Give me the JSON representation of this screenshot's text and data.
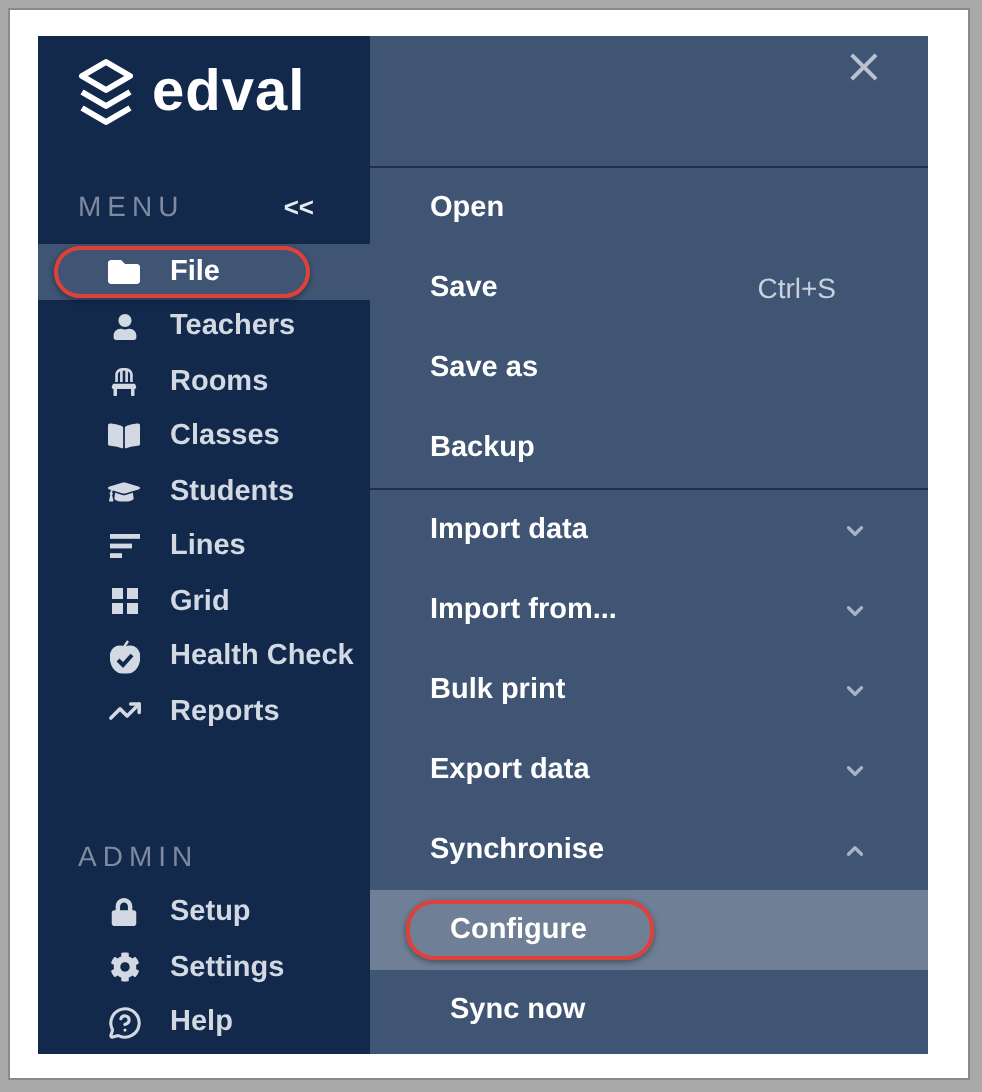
{
  "logo": {
    "text": "edval"
  },
  "sidebar": {
    "heading": "MENU",
    "collapse": "<<",
    "items": [
      {
        "label": "File",
        "selected": true,
        "circled": true
      },
      {
        "label": "Teachers",
        "selected": false,
        "circled": false
      },
      {
        "label": "Rooms",
        "selected": false,
        "circled": false
      },
      {
        "label": "Classes",
        "selected": false,
        "circled": false
      },
      {
        "label": "Students",
        "selected": false,
        "circled": false
      },
      {
        "label": "Lines",
        "selected": false,
        "circled": false
      },
      {
        "label": "Grid",
        "selected": false,
        "circled": false
      },
      {
        "label": "Health Check",
        "selected": false,
        "circled": false
      },
      {
        "label": "Reports",
        "selected": false,
        "circled": false
      }
    ],
    "admin_heading": "ADMIN",
    "admin_items": [
      {
        "label": "Setup",
        "selected": false
      },
      {
        "label": "Settings",
        "selected": false
      },
      {
        "label": "Help",
        "selected": false
      }
    ]
  },
  "file_menu": {
    "close": "×",
    "groups": [
      [
        {
          "label": "Open"
        },
        {
          "label": "Save",
          "shortcut": "Ctrl+S"
        },
        {
          "label": "Save as"
        },
        {
          "label": "Backup"
        }
      ],
      [
        {
          "label": "Import data",
          "expanded": false
        },
        {
          "label": "Import from...",
          "expanded": false
        },
        {
          "label": "Bulk print",
          "expanded": false
        },
        {
          "label": "Export data",
          "expanded": false
        },
        {
          "label": "Synchronise",
          "expanded": true,
          "children": [
            {
              "label": "Configure",
              "selected": true,
              "circled": true
            },
            {
              "label": "Sync now",
              "selected": false,
              "circled": false
            }
          ]
        }
      ]
    ]
  }
}
